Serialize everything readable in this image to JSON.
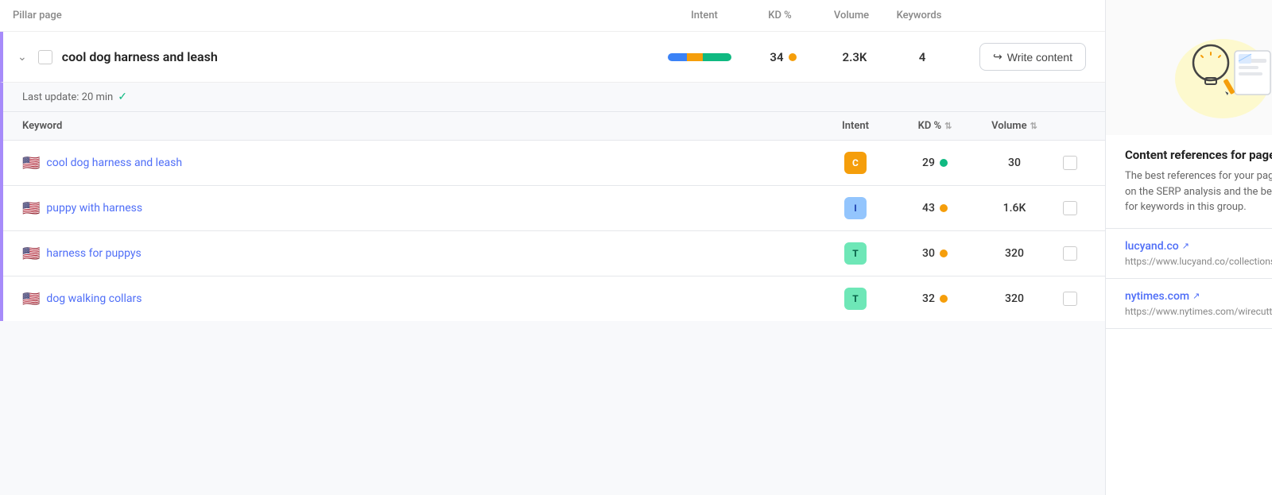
{
  "header": {
    "pillar_label": "Pillar page",
    "intent_label": "Intent",
    "kd_label": "KD %",
    "volume_label": "Volume",
    "keywords_label": "Keywords"
  },
  "pillar": {
    "title": "cool dog harness and leash",
    "kd_value": "34",
    "volume_value": "2.3K",
    "keywords_value": "4",
    "intent_segments": [
      30,
      25,
      45
    ],
    "write_button": "Write content"
  },
  "last_update": {
    "text": "Last update: 20 min"
  },
  "sub_table": {
    "headers": {
      "keyword": "Keyword",
      "intent": "Intent",
      "kd": "KD %",
      "volume": "Volume"
    },
    "rows": [
      {
        "flag": "🇺🇸",
        "keyword": "cool dog harness and leash",
        "intent_badge": "C",
        "intent_class": "badge-c",
        "kd_value": "29",
        "kd_dot": "green",
        "volume": "30"
      },
      {
        "flag": "🇺🇸",
        "keyword": "puppy with harness",
        "intent_badge": "I",
        "intent_class": "badge-i",
        "kd_value": "43",
        "kd_dot": "yellow",
        "volume": "1.6K"
      },
      {
        "flag": "🇺🇸",
        "keyword": "harness for puppys",
        "intent_badge": "T",
        "intent_class": "badge-t",
        "kd_value": "30",
        "kd_dot": "yellow",
        "volume": "320"
      },
      {
        "flag": "🇺🇸",
        "keyword": "dog walking collars",
        "intent_badge": "T",
        "intent_class": "badge-t",
        "kd_value": "32",
        "kd_dot": "yellow",
        "volume": "320"
      }
    ]
  },
  "sidebar": {
    "title": "Content references for page",
    "description": "The best references for your pages. Based on the SERP analysis and the best articles for keywords in this group.",
    "references": [
      {
        "domain": "lucyand.co",
        "url": "https://www.lucyand.co/collections/harness..."
      },
      {
        "domain": "nytimes.com",
        "url": "https://www.nytimes.com/wirecutter/review..."
      }
    ]
  }
}
